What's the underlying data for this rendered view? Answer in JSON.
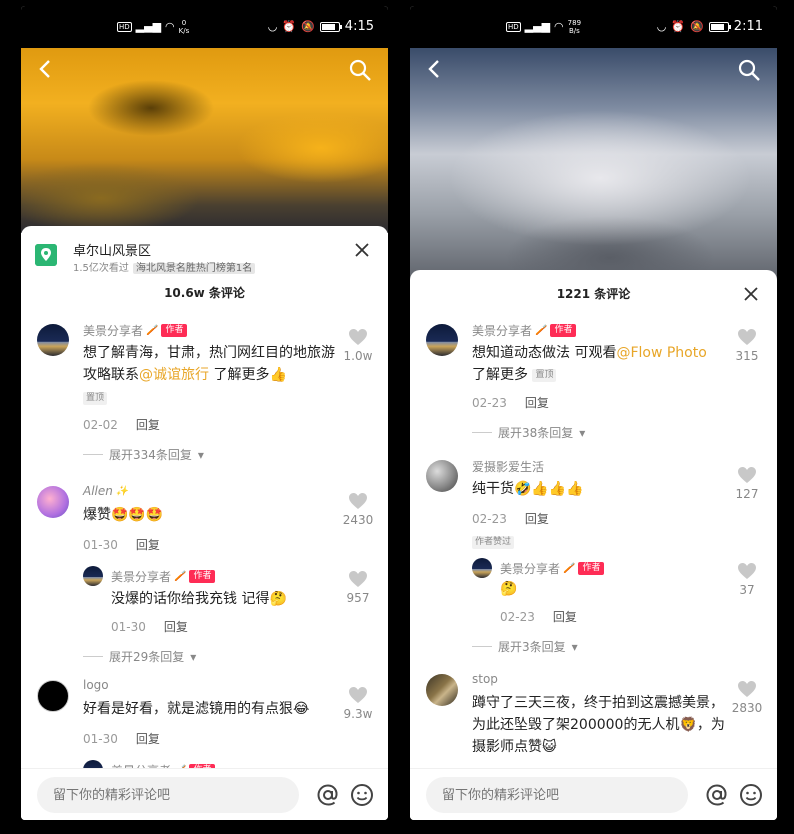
{
  "left": {
    "status": {
      "speed_value": "0",
      "speed_unit": "K/s",
      "time": "4:15",
      "battery_level": 0.85
    },
    "poi": {
      "name": "卓尔山风景区",
      "views": "1.5亿次看过",
      "rank": "海北风景名胜热门榜第1名"
    },
    "title": "10.6w 条评论",
    "comments": [
      {
        "name": "美景分享者",
        "decor": "🪥",
        "author_tag": "作者",
        "text_a": "想了解青海，甘肃，热门网红目的地旅游攻略联系",
        "mention": "@诚谊旅行",
        "text_b": " 了解更多👍",
        "pin": "置顶",
        "date": "02-02",
        "reply": "回复",
        "likes": "1.0w",
        "expand": "展开334条回复"
      },
      {
        "name": "Allen",
        "decor": "✨",
        "text": "爆赞🤩🤩🤩",
        "date": "01-30",
        "reply": "回复",
        "likes": "2430"
      },
      {
        "name": "美景分享者",
        "decor": "🪥",
        "author_tag": "作者",
        "text": "没爆的话你给我充钱 记得🤔",
        "date": "01-30",
        "reply": "回复",
        "likes": "957",
        "expand": "展开29条回复"
      },
      {
        "name": "logo",
        "text": "好看是好看，就是滤镜用的有点狠😂",
        "date": "01-30",
        "reply": "回复",
        "likes": "9.3w"
      },
      {
        "name": "美景分享者",
        "decor": "🪥",
        "author_tag": "作者"
      }
    ],
    "input_placeholder": "留下你的精彩评论吧"
  },
  "right": {
    "status": {
      "speed_value": "789",
      "speed_unit": "B/s",
      "time": "2:11",
      "battery_level": 0.85
    },
    "title": "1221 条评论",
    "comments": [
      {
        "name": "美景分享者",
        "decor": "🪥",
        "author_tag": "作者",
        "text_a": "想知道动态做法 可观看",
        "mention": "@Flow Photo",
        "text_b": "了解更多",
        "pin": "置顶",
        "date": "02-23",
        "reply": "回复",
        "likes": "315",
        "expand": "展开38条回复"
      },
      {
        "name": "爱摄影爱生活",
        "text": "纯干货🤣👍👍👍",
        "date": "02-23",
        "reply": "回复",
        "liked_by_author": "作者赞过",
        "likes": "127"
      },
      {
        "name": "美景分享者",
        "decor": "🪥",
        "author_tag": "作者",
        "text": "🤔",
        "date": "02-23",
        "reply": "回复",
        "likes": "37",
        "expand": "展开3条回复"
      },
      {
        "name": "stop",
        "text": "蹲守了三天三夜，终于拍到这震撼美景，为此还坠毁了架200000的无人机🦁，为摄影师点赞😺",
        "likes": "2830"
      }
    ],
    "input_placeholder": "留下你的精彩评论吧"
  },
  "colors": {
    "author_tag": "#fe2c55",
    "mention": "#e8a628",
    "poi": "#2bb673"
  },
  "icons": [
    "back-icon",
    "search-icon",
    "close-icon",
    "heart-icon",
    "at-icon",
    "emoji-icon",
    "location-icon"
  ]
}
